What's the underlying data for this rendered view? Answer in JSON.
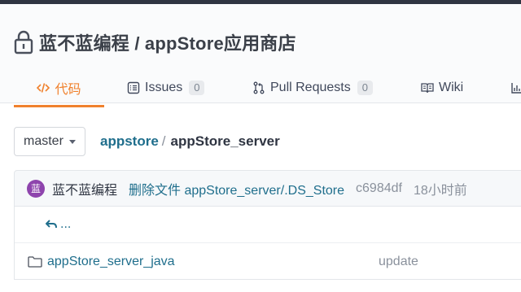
{
  "repo": {
    "title": "蓝不蓝编程 / appStore应用商店"
  },
  "tabs": [
    {
      "label": "代码",
      "icon": "code-icon",
      "active": true
    },
    {
      "label": "Issues",
      "count": "0",
      "icon": "issues-icon"
    },
    {
      "label": "Pull Requests",
      "count": "0",
      "icon": "pull-request-icon"
    },
    {
      "label": "Wiki",
      "icon": "wiki-icon"
    },
    {
      "label": "",
      "icon": "stats-icon"
    }
  ],
  "branch": {
    "selected": "master"
  },
  "breadcrumb": {
    "repo": "appstore",
    "separator": "/",
    "current": "appStore_server"
  },
  "commit": {
    "avatar_letter": "蓝",
    "author": "蓝不蓝编程",
    "message": "删除文件 appStore_server/.DS_Store",
    "sha": "c6984df",
    "time": "18小时前"
  },
  "files": {
    "parent_link": "...",
    "items": [
      {
        "name": "appStore_server_java",
        "type": "folder",
        "last_commit": "update"
      }
    ]
  },
  "colors": {
    "accent": "#f0812d",
    "link": "#1f6e8c",
    "avatar": "#8e44ad"
  }
}
